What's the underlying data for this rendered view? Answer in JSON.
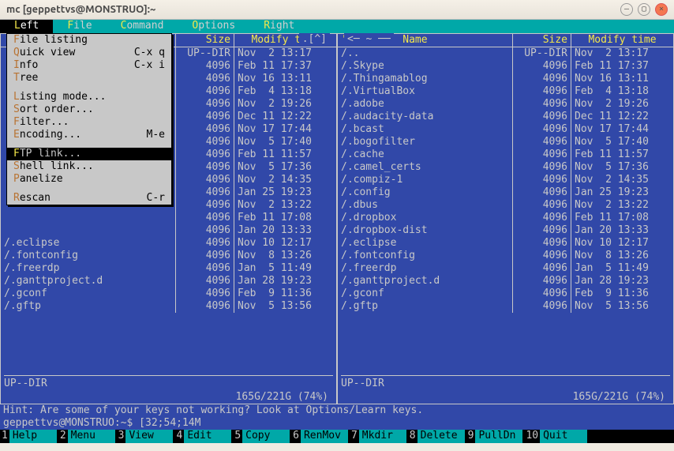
{
  "window": {
    "title": "mc [geppettvs@MONSTRUO]:~"
  },
  "menubar": [
    {
      "hotkey": "L",
      "label": "eft",
      "active": true
    },
    {
      "hotkey": "F",
      "label": "ile"
    },
    {
      "hotkey": "C",
      "label": "ommand"
    },
    {
      "hotkey": "O",
      "label": "ptions"
    },
    {
      "hotkey": "R",
      "label": "ight"
    }
  ],
  "dropdown": {
    "groups": [
      [
        {
          "hk": "F",
          "label": "ile listing",
          "short": ""
        },
        {
          "hk": "Q",
          "label": "uick view",
          "short": "C-x q"
        },
        {
          "hk": "I",
          "label": "nfo",
          "short": "C-x i"
        },
        {
          "hk": "T",
          "label": "ree",
          "short": ""
        }
      ],
      [
        {
          "hk": "L",
          "label": "isting mode...",
          "short": ""
        },
        {
          "hk": "S",
          "label": "ort order...",
          "short": ""
        },
        {
          "hk": "F",
          "label": "ilter...",
          "short": ""
        },
        {
          "hk": "E",
          "label": "ncoding...",
          "short": "M-e"
        }
      ],
      [
        {
          "hk": "F",
          "label": "TP link...",
          "short": "",
          "selected": true
        },
        {
          "hk": "S",
          "label": "hell link...",
          "short": ""
        },
        {
          "hk": "P",
          "label": "anelize",
          "short": ""
        }
      ],
      [
        {
          "hk": "R",
          "label": "escan",
          "short": "C-r"
        }
      ]
    ]
  },
  "left_panel": {
    "title_tail": ".[^]",
    "cols": {
      "name": "'n",
      "size": "Size",
      "mtime": "Modify time"
    },
    "status": "UP--DIR",
    "usage": "165G/221G (74%)",
    "rows": [
      {
        "name": "",
        "size": "UP--DIR",
        "mtime": "Nov  2 13:17"
      },
      {
        "name": "",
        "size": "4096",
        "mtime": "Feb 11 17:37"
      },
      {
        "name": "",
        "size": "4096",
        "mtime": "Nov 16 13:11"
      },
      {
        "name": "",
        "size": "4096",
        "mtime": "Feb  4 13:18"
      },
      {
        "name": "",
        "size": "4096",
        "mtime": "Nov  2 19:26"
      },
      {
        "name": "",
        "size": "4096",
        "mtime": "Dec 11 12:22"
      },
      {
        "name": "",
        "size": "4096",
        "mtime": "Nov 17 17:44"
      },
      {
        "name": "",
        "size": "4096",
        "mtime": "Nov  5 17:40"
      },
      {
        "name": "",
        "size": "4096",
        "mtime": "Feb 11 11:57"
      },
      {
        "name": "",
        "size": "4096",
        "mtime": "Nov  5 17:36"
      },
      {
        "name": "",
        "size": "4096",
        "mtime": "Nov  2 14:35"
      },
      {
        "name": "",
        "size": "4096",
        "mtime": "Jan 25 19:23"
      },
      {
        "name": "",
        "size": "4096",
        "mtime": "Nov  2 13:22"
      },
      {
        "name": "",
        "size": "4096",
        "mtime": "Feb 11 17:08"
      },
      {
        "name": "",
        "size": "4096",
        "mtime": "Jan 20 13:33"
      },
      {
        "name": "/.eclipse",
        "size": "4096",
        "mtime": "Nov 10 12:17"
      },
      {
        "name": "/.fontconfig",
        "size": "4096",
        "mtime": "Nov  8 13:26"
      },
      {
        "name": "/.freerdp",
        "size": "4096",
        "mtime": "Jan  5 11:49"
      },
      {
        "name": "/.ganttproject.d",
        "size": "4096",
        "mtime": "Jan 28 19:23"
      },
      {
        "name": "/.gconf",
        "size": "4096",
        "mtime": "Feb  9 11:36"
      },
      {
        "name": "/.gftp",
        "size": "4096",
        "mtime": "Nov  5 13:56"
      }
    ]
  },
  "right_panel": {
    "title_head": "<",
    "title_tail": "~ ──",
    "cols": {
      "name_tick": "'n",
      "name": "Name",
      "size": "Size",
      "mtime": "Modify time"
    },
    "status": "UP--DIR",
    "usage": "165G/221G (74%)",
    "rows": [
      {
        "name": "/..",
        "size": "UP--DIR",
        "mtime": "Nov  2 13:17"
      },
      {
        "name": "/.Skype",
        "size": "4096",
        "mtime": "Feb 11 17:37"
      },
      {
        "name": "/.Thingamablog",
        "size": "4096",
        "mtime": "Nov 16 13:11"
      },
      {
        "name": "/.VirtualBox",
        "size": "4096",
        "mtime": "Feb  4 13:18"
      },
      {
        "name": "/.adobe",
        "size": "4096",
        "mtime": "Nov  2 19:26"
      },
      {
        "name": "/.audacity-data",
        "size": "4096",
        "mtime": "Dec 11 12:22"
      },
      {
        "name": "/.bcast",
        "size": "4096",
        "mtime": "Nov 17 17:44"
      },
      {
        "name": "/.bogofilter",
        "size": "4096",
        "mtime": "Nov  5 17:40"
      },
      {
        "name": "/.cache",
        "size": "4096",
        "mtime": "Feb 11 11:57"
      },
      {
        "name": "/.camel_certs",
        "size": "4096",
        "mtime": "Nov  5 17:36"
      },
      {
        "name": "/.compiz-1",
        "size": "4096",
        "mtime": "Nov  2 14:35"
      },
      {
        "name": "/.config",
        "size": "4096",
        "mtime": "Jan 25 19:23"
      },
      {
        "name": "/.dbus",
        "size": "4096",
        "mtime": "Nov  2 13:22"
      },
      {
        "name": "/.dropbox",
        "size": "4096",
        "mtime": "Feb 11 17:08"
      },
      {
        "name": "/.dropbox-dist",
        "size": "4096",
        "mtime": "Jan 20 13:33"
      },
      {
        "name": "/.eclipse",
        "size": "4096",
        "mtime": "Nov 10 12:17"
      },
      {
        "name": "/.fontconfig",
        "size": "4096",
        "mtime": "Nov  8 13:26"
      },
      {
        "name": "/.freerdp",
        "size": "4096",
        "mtime": "Jan  5 11:49"
      },
      {
        "name": "/.ganttproject.d",
        "size": "4096",
        "mtime": "Jan 28 19:23"
      },
      {
        "name": "/.gconf",
        "size": "4096",
        "mtime": "Feb  9 11:36"
      },
      {
        "name": "/.gftp",
        "size": "4096",
        "mtime": "Nov  5 13:56"
      }
    ]
  },
  "hint": "Hint: Are some of your keys not working? Look at Options/Learn keys.",
  "prompt": "geppettvs@MONSTRUO:~$ [32;54;14M",
  "fnkeys": [
    {
      "num": "1",
      "label": "Help"
    },
    {
      "num": "2",
      "label": "Menu"
    },
    {
      "num": "3",
      "label": "View"
    },
    {
      "num": "4",
      "label": "Edit"
    },
    {
      "num": "5",
      "label": "Copy"
    },
    {
      "num": "6",
      "label": "RenMov"
    },
    {
      "num": "7",
      "label": "Mkdir"
    },
    {
      "num": "8",
      "label": "Delete"
    },
    {
      "num": "9",
      "label": "PullDn"
    },
    {
      "num": "10",
      "label": "Quit"
    }
  ]
}
